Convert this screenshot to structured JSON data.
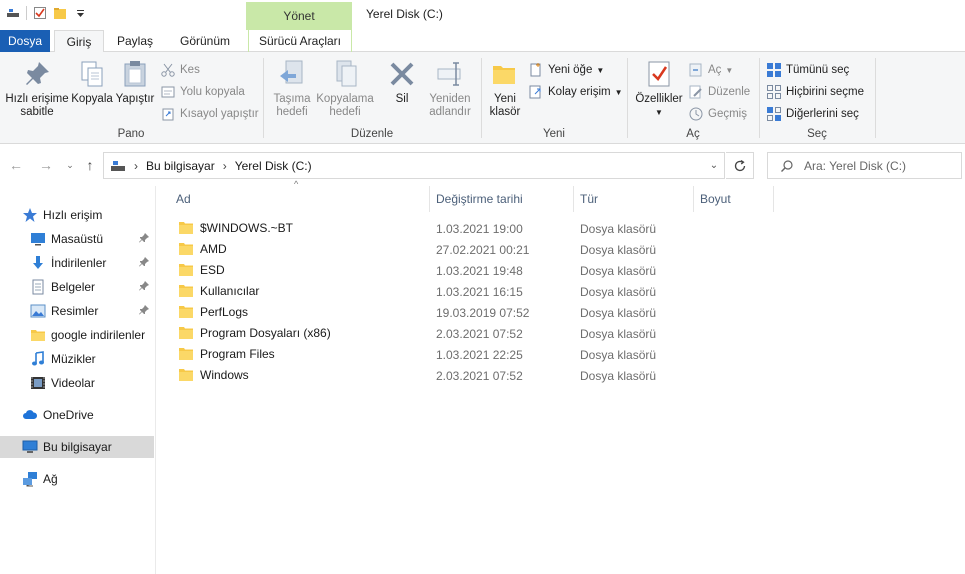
{
  "window": {
    "title": "Yerel Disk (C:)"
  },
  "contextual_tab": {
    "label": "Yönet"
  },
  "tabs": [
    {
      "label": "Dosya"
    },
    {
      "label": "Giriş"
    },
    {
      "label": "Paylaş"
    },
    {
      "label": "Görünüm"
    },
    {
      "label": "Sürücü Araçları"
    }
  ],
  "ribbon": {
    "pano": {
      "label": "Pano",
      "pin_label_1": "Hızlı erişime",
      "pin_label_2": "sabitle",
      "copy": "Kopyala",
      "paste": "Yapıştır",
      "cut": "Kes",
      "copy_path": "Yolu kopyala",
      "paste_shortcut": "Kısayol yapıştır"
    },
    "duzenle": {
      "label": "Düzenle",
      "move_1": "Taşıma",
      "move_2": "hedefi",
      "copyto_1": "Kopyalama",
      "copyto_2": "hedefi",
      "delete": "Sil",
      "rename_1": "Yeniden",
      "rename_2": "adlandır"
    },
    "yeni": {
      "label": "Yeni",
      "newfolder_1": "Yeni",
      "newfolder_2": "klasör",
      "new_item": "Yeni öğe",
      "easy_access": "Kolay erişim"
    },
    "ac": {
      "label": "Aç",
      "properties": "Özellikler",
      "open": "Aç",
      "edit": "Düzenle",
      "history": "Geçmiş"
    },
    "sec": {
      "label": "Seç",
      "select_all": "Tümünü seç",
      "select_none": "Hiçbirini seçme",
      "invert": "Diğerlerini seç"
    }
  },
  "address": {
    "crumbs": [
      "Bu bilgisayar",
      "Yerel Disk (C:)"
    ],
    "search_placeholder": "Ara: Yerel Disk (C:)"
  },
  "nav": {
    "quick_access": "Hızlı erişim",
    "items": [
      {
        "label": "Masaüstü",
        "icon": "desktop-icon",
        "pinned": true
      },
      {
        "label": "İndirilenler",
        "icon": "download-icon",
        "pinned": true
      },
      {
        "label": "Belgeler",
        "icon": "document-icon",
        "pinned": true
      },
      {
        "label": "Resimler",
        "icon": "pictures-icon",
        "pinned": true
      },
      {
        "label": "google indirilenler",
        "icon": "folder-icon",
        "pinned": false
      },
      {
        "label": "Müzikler",
        "icon": "music-icon",
        "pinned": false
      },
      {
        "label": "Videolar",
        "icon": "video-icon",
        "pinned": false
      }
    ],
    "onedrive": "OneDrive",
    "this_pc": "Bu bilgisayar",
    "network": "Ağ"
  },
  "columns": {
    "name": "Ad",
    "date": "Değiştirme tarihi",
    "type": "Tür",
    "size": "Boyut"
  },
  "files": [
    {
      "name": "$WINDOWS.~BT",
      "date": "1.03.2021 19:00",
      "type": "Dosya klasörü"
    },
    {
      "name": "AMD",
      "date": "27.02.2021 00:21",
      "type": "Dosya klasörü"
    },
    {
      "name": "ESD",
      "date": "1.03.2021 19:48",
      "type": "Dosya klasörü"
    },
    {
      "name": "Kullanıcılar",
      "date": "1.03.2021 16:15",
      "type": "Dosya klasörü"
    },
    {
      "name": "PerfLogs",
      "date": "19.03.2019 07:52",
      "type": "Dosya klasörü"
    },
    {
      "name": "Program Dosyaları (x86)",
      "date": "2.03.2021 07:52",
      "type": "Dosya klasörü"
    },
    {
      "name": "Program Files",
      "date": "1.03.2021 22:25",
      "type": "Dosya klasörü"
    },
    {
      "name": "Windows",
      "date": "2.03.2021 07:52",
      "type": "Dosya klasörü"
    }
  ],
  "colors": {
    "accent": "#1a5fb4",
    "contextual_tab": "#c9e8a8",
    "folder": "#f7c948",
    "selected": "#d9d9d9"
  }
}
